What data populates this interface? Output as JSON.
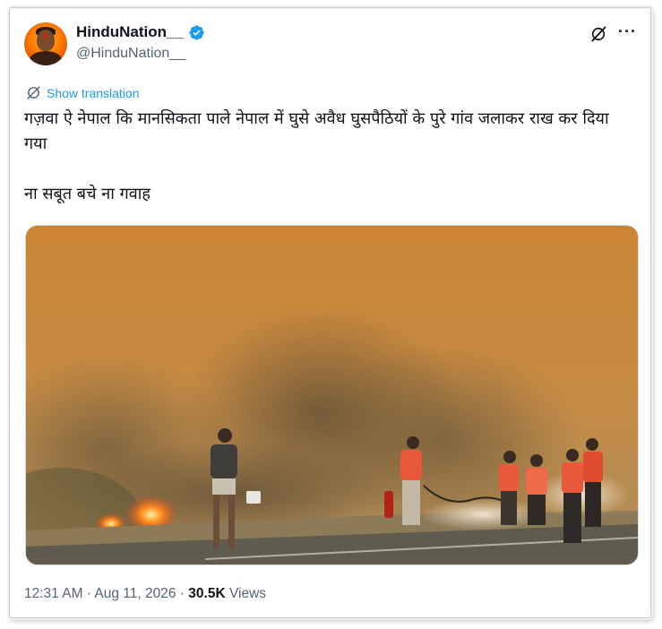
{
  "author": {
    "display_name": "HinduNation__",
    "handle": "@HinduNation__",
    "verified": true,
    "avatar_icon": "avatar-saffron-portrait"
  },
  "header_icons": {
    "grok": "grok-icon",
    "more": "more-icon",
    "more_glyph": "···"
  },
  "translation": {
    "label": "Show translation",
    "icon": "globe-icon"
  },
  "tweet": {
    "line1": "गज़वा ऐ नेपाल कि मानसिकता पाले नेपाल में घुसे अवैध घुसपैठियों के पुरे गांव जलाकर राख कर दिया गया",
    "line2": "ना सबूत बचे ना गवाह"
  },
  "meta": {
    "time": "12:31 AM",
    "sep1": " · ",
    "date": "Aug 11, 2026",
    "sep2": " · ",
    "views_count": "30.5K",
    "views_label": " Views"
  },
  "colors": {
    "accent": "#1d9bf0",
    "text": "#0f1419",
    "secondary": "#536471",
    "smoke": "#c98a3e"
  }
}
